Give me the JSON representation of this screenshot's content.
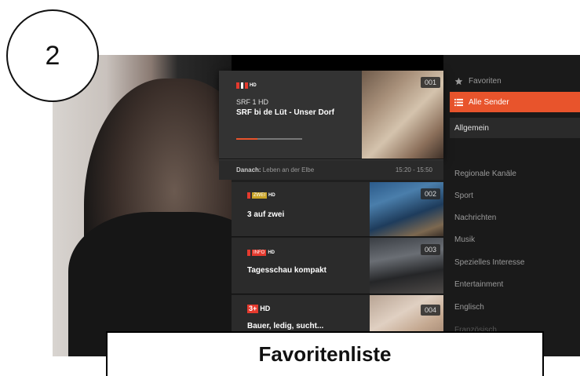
{
  "step": {
    "number": "2"
  },
  "channels": [
    {
      "number": "001",
      "logo": "SRF 1 HD",
      "channel_name": "SRF 1 HD",
      "title": "SRF bi de Lüt - Unser Dorf",
      "progress": 0.32
    },
    {
      "number": "002",
      "logo": "ZWEI HD",
      "title": "3 auf zwei"
    },
    {
      "number": "003",
      "logo": "INFO HD",
      "title": "Tagesschau kompakt"
    },
    {
      "number": "004",
      "logo": "3+HD",
      "title": "Bauer, ledig, sucht..."
    }
  ],
  "next": {
    "label": "Danach:",
    "title": "Leben an der Elbe",
    "time": "15:20 - 15:50"
  },
  "menu": {
    "favorites": "Favoriten",
    "all_channels": "Alle Sender",
    "general": "Allgemein",
    "categories": [
      "Regionale Kanäle",
      "Sport",
      "Nachrichten",
      "Musik",
      "Spezielles Interesse",
      "Entertainment",
      "Englisch",
      "Französisch"
    ]
  },
  "caption": "Favoritenliste",
  "colors": {
    "accent": "#e8542c",
    "background": "#1f1f1f"
  },
  "icons": {
    "favorites": "star-icon",
    "all_channels": "list-icon"
  }
}
